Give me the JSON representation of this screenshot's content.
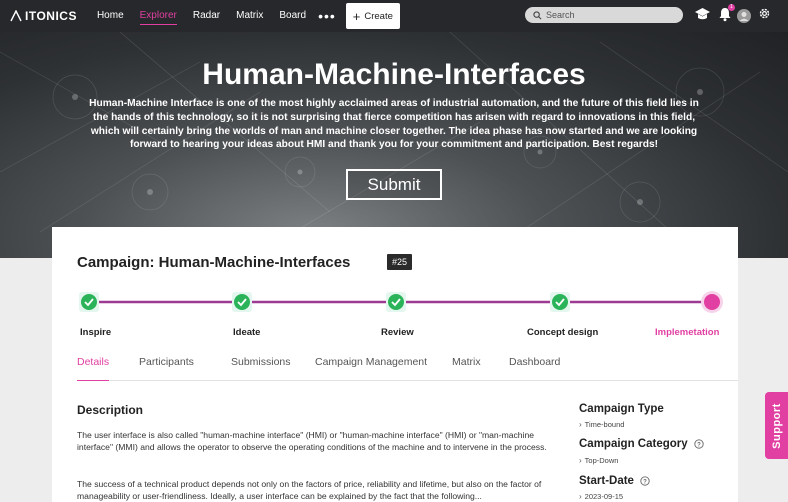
{
  "brand": {
    "logo_text": "ITONICS",
    "accent_color": "#e13fa1",
    "dark_color": "#26282b"
  },
  "nav": {
    "items": [
      {
        "label": "Home",
        "active": false
      },
      {
        "label": "Explorer",
        "active": true
      },
      {
        "label": "Radar",
        "active": false
      },
      {
        "label": "Matrix",
        "active": false
      },
      {
        "label": "Board",
        "active": false
      }
    ],
    "more_icon": "ellipsis-icon",
    "create_label": "Create",
    "search_placeholder": "Search",
    "notification_count": "1"
  },
  "hero": {
    "title": "Human-Machine-Interfaces",
    "description": "Human-Machine Interface is one of the most highly acclaimed areas of industrial automation, and the future of this field lies in the hands of this technology, so it is not surprising that fierce competition has arisen with regard to innovations in this field, which will certainly bring the worlds of man and machine closer together. The idea phase has now started and we are looking forward to hearing your ideas about HMI and thank you for your commitment and participation. Best regards!",
    "submit_label": "Submit"
  },
  "campaign": {
    "title": "Campaign: Human-Machine-Interfaces",
    "id_badge": "#25",
    "steps": [
      {
        "label": "Inspire",
        "status": "done"
      },
      {
        "label": "Ideate",
        "status": "done"
      },
      {
        "label": "Review",
        "status": "done"
      },
      {
        "label": "Concept design",
        "status": "done"
      },
      {
        "label": "Implemetation",
        "status": "current"
      }
    ],
    "tabs": [
      {
        "label": "Details",
        "active": true
      },
      {
        "label": "Participants",
        "active": false
      },
      {
        "label": "Submissions",
        "active": false
      },
      {
        "label": "Campaign Management",
        "active": false
      },
      {
        "label": "Matrix",
        "active": false
      },
      {
        "label": "Dashboard",
        "active": false
      }
    ],
    "description": {
      "heading": "Description",
      "paragraphs": [
        "The user interface is also called \"human-machine interface\" (HMI) or \"human-machine interface\" (HMI) or \"man-machine interface\" (MMI) and allows the operator to observe the operating conditions of the machine and to intervene in the process.",
        "The success of a technical product depends not only on the factors of price, reliability and lifetime, but also on the factor of manageability or user-friendliness. Ideally, a user interface can be explained by the fact that the following..."
      ]
    },
    "sidebar": {
      "type_heading": "Campaign Type",
      "type_value": "Time-bound",
      "category_heading": "Campaign Category",
      "category_value": "Top-Down",
      "start_heading": "Start-Date",
      "start_value": "2023-09-15"
    }
  },
  "support_label": "Support"
}
